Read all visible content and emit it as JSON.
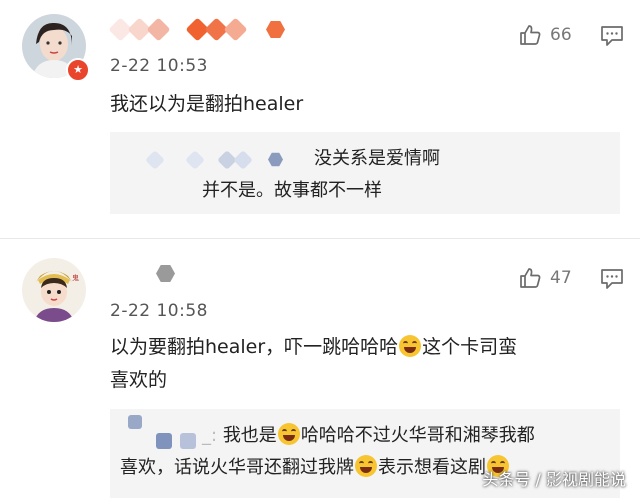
{
  "comments": [
    {
      "time": "2-22 10:53",
      "likes": "66",
      "text": "我还以为是翻拍healer",
      "reply_name_suffix": "",
      "reply_text": "没关系是爱情啊",
      "reply_text2": "并不是。故事都不一样",
      "colors": {
        "badge": "#e8452c"
      }
    },
    {
      "time": "2-22 10:58",
      "likes": "47",
      "text_line1": "以为要翻拍healer，吓一跳哈哈哈",
      "text_line1_after": "这个卡司蛮",
      "text_line2": "喜欢的",
      "reply_name_suffix": "_:",
      "reply_part1": "我也是",
      "reply_part2": "哈哈哈不过火华哥和湘琴我都",
      "reply_line2a": "喜欢，话说火华哥还翻过我牌",
      "reply_line2b": "表示想看这剧"
    }
  ],
  "icons": [
    "thumbs-up-icon",
    "reply-comment-icon",
    "laughing-emoji-icon",
    "grin-emoji-icon",
    "verified-badge-icon"
  ],
  "watermark": "头条号 / 影视剧能说"
}
